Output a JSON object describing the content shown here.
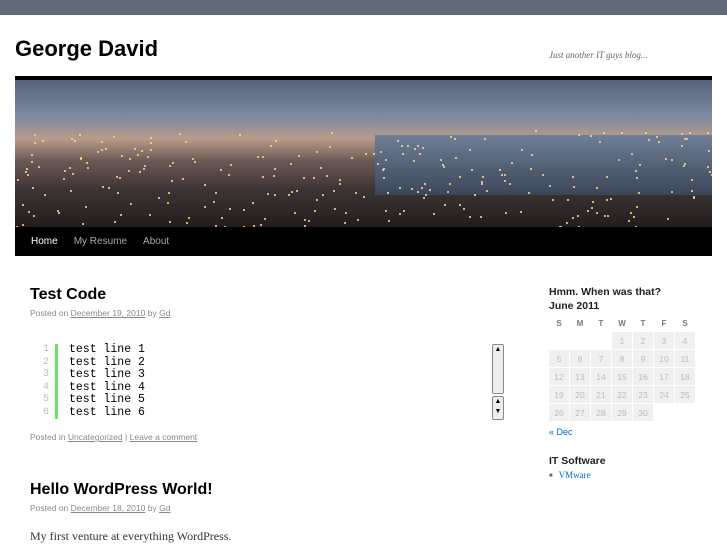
{
  "site": {
    "title": "George David",
    "description": "Just another IT guys blog..."
  },
  "nav": [
    "Home",
    "My Resume",
    "About"
  ],
  "posts": [
    {
      "title": "Test Code",
      "posted_on": "Posted on",
      "date": "December 19, 2010",
      "by": "by",
      "author": "Gd",
      "code": {
        "line_numbers": [
          "1",
          "2",
          "3",
          "4",
          "5",
          "6"
        ],
        "lines": [
          "test line 1",
          "test line 2",
          "test line 3",
          "test line 4",
          "test line 5",
          "test line 6"
        ]
      },
      "posted_in": "Posted in",
      "category": "Uncategorized",
      "sep": "|",
      "comment": "Leave a comment"
    },
    {
      "title": "Hello WordPress World!",
      "posted_on": "Posted on",
      "date": "December 18, 2010",
      "by": "by",
      "author": "Gd",
      "excerpt": "My first venture at everything WordPress."
    }
  ],
  "sidebar": {
    "calendar_title": "Hmm. When was that?",
    "month": "June 2011",
    "weekdays": [
      "S",
      "M",
      "T",
      "W",
      "T",
      "F",
      "S"
    ],
    "weeks": [
      [
        "",
        "",
        "",
        "1",
        "2",
        "3",
        "4"
      ],
      [
        "5",
        "6",
        "7",
        "8",
        "9",
        "10",
        "11"
      ],
      [
        "12",
        "13",
        "14",
        "15",
        "16",
        "17",
        "18"
      ],
      [
        "19",
        "20",
        "21",
        "22",
        "23",
        "24",
        "25"
      ],
      [
        "26",
        "27",
        "28",
        "29",
        "30",
        "",
        ""
      ]
    ],
    "prev": "« Dec",
    "links_title": "IT Software",
    "links": [
      "VMware"
    ]
  }
}
